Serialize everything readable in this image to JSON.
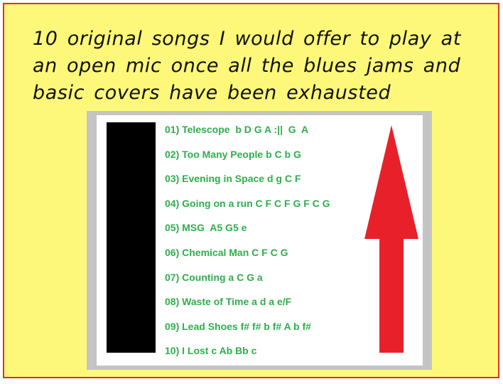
{
  "heading": "10 original songs I would offer to play at an open mic once all the blues jams and basic covers have been exhausted",
  "songs": [
    "01) Telescope  b D G A :||  G  A",
    "02) Too Many People b C b G",
    "03) Evening in Space d g C F",
    "04) Going on a run C F C F G F C G",
    "05) MSG  A5 G5 e",
    "06) Chemical Man C F C G",
    "07) Counting a C G a",
    "08) Waste of Time a d a e/F",
    "09) Lead Shoes f# f# b f# A b f#",
    "10) I Lost c Ab Bb c"
  ],
  "colors": {
    "background": "#fdf87a",
    "border": "#e0302a",
    "song_text": "#2fae4c",
    "arrow": "#e8202a",
    "bar": "#000000",
    "panel_frame": "#c4c4c4"
  },
  "icons": {
    "arrow": "up-arrow-icon"
  }
}
